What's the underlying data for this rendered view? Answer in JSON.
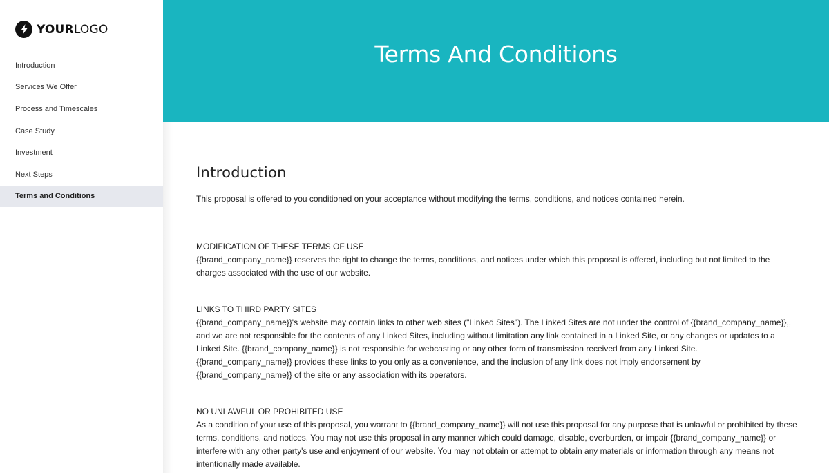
{
  "brand": {
    "logo_bold": "YOUR",
    "logo_light": "LOGO",
    "logo_icon": "lightning-bolt-icon",
    "accent_color": "#19b5c0"
  },
  "sidebar": {
    "items": [
      {
        "label": "Introduction",
        "active": false
      },
      {
        "label": "Services We Offer",
        "active": false
      },
      {
        "label": "Process and Timescales",
        "active": false
      },
      {
        "label": "Case Study",
        "active": false
      },
      {
        "label": "Investment",
        "active": false
      },
      {
        "label": "Next Steps",
        "active": false
      },
      {
        "label": "Terms and Conditions",
        "active": true
      }
    ]
  },
  "header": {
    "title": "Terms And Conditions"
  },
  "content": {
    "section_title": "Introduction",
    "intro": "This proposal is offered to you conditioned on your acceptance without modifying the terms, conditions, and notices contained herein.",
    "blocks": [
      {
        "title": "MODIFICATION OF THESE TERMS OF USE",
        "lines": [
          "{{brand_company_name}} reserves the right to change the terms, conditions, and notices under which this proposal is offered, including but not limited to the charges associated with the use of our website."
        ]
      },
      {
        "title": "LINKS TO THIRD PARTY SITES",
        "lines": [
          "{{brand_company_name}}'s website may contain links to other web sites (\"Linked Sites\"). The Linked Sites are not under the control of {{brand_company_name}},, and we are not responsible for the contents of any Linked Sites, including without limitation any link contained in a Linked Site, or any changes or updates to a Linked Site. {{brand_company_name}} is not responsible for webcasting or any other form of transmission received from any Linked Site.",
          "{{brand_company_name}} provides these links to you only as a convenience, and the inclusion of any link does not imply endorsement by {{brand_company_name}} of the site or any association with its operators."
        ]
      },
      {
        "title": "NO UNLAWFUL OR PROHIBITED USE",
        "lines": [
          "As a condition of your use of this proposal, you warrant to {{brand_company_name}} will not use this proposal for any purpose that is unlawful or prohibited by these terms, conditions, and notices. You may not use this proposal in any manner which could damage, disable, overburden, or impair {{brand_company_name}} or interfere with any other party's use and enjoyment of our website. You may not obtain or attempt to obtain any materials or information through any means not intentionally made available."
        ]
      }
    ]
  }
}
